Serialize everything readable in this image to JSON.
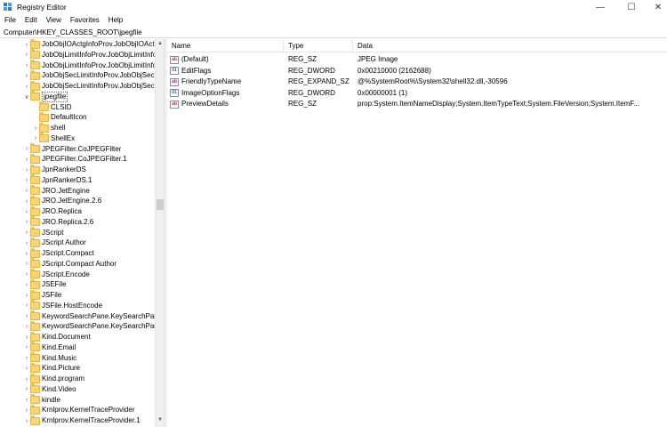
{
  "window": {
    "title": "Registry Editor",
    "min_glyph": "—",
    "max_glyph": "☐",
    "close_glyph": "✕"
  },
  "menu": [
    "File",
    "Edit",
    "View",
    "Favorites",
    "Help"
  ],
  "address": "Computer\\HKEY_CLASSES_ROOT\\jpegfile",
  "tree": [
    {
      "label": "JobObjIOActgInfoProv.JobObjIOActgI",
      "level": 0,
      "expandable": true,
      "expanded": false,
      "selected": false
    },
    {
      "label": "JobObjLimitInfoProv.JobObjLimitInfo",
      "level": 0,
      "expandable": true,
      "expanded": false,
      "selected": false
    },
    {
      "label": "JobObjLimitInfoProv.JobObjLimitInfo",
      "level": 0,
      "expandable": true,
      "expanded": false,
      "selected": false
    },
    {
      "label": "JobObjSecLimitInfoProv.JobObjSecLi",
      "level": 0,
      "expandable": true,
      "expanded": false,
      "selected": false
    },
    {
      "label": "JobObjSecLimitInfoProv.JobObjSecLi",
      "level": 0,
      "expandable": true,
      "expanded": false,
      "selected": false
    },
    {
      "label": "jpegfile",
      "level": 0,
      "expandable": true,
      "expanded": true,
      "selected": true
    },
    {
      "label": "CLSID",
      "level": 1,
      "expandable": false,
      "expanded": false,
      "selected": false
    },
    {
      "label": "DefaultIcon",
      "level": 1,
      "expandable": false,
      "expanded": false,
      "selected": false
    },
    {
      "label": "shell",
      "level": 1,
      "expandable": true,
      "expanded": false,
      "selected": false
    },
    {
      "label": "ShellEx",
      "level": 1,
      "expandable": true,
      "expanded": false,
      "selected": false
    },
    {
      "label": "JPEGFilter.CoJPEGFilter",
      "level": 0,
      "expandable": true,
      "expanded": false,
      "selected": false
    },
    {
      "label": "JPEGFilter.CoJPEGFilter.1",
      "level": 0,
      "expandable": true,
      "expanded": false,
      "selected": false
    },
    {
      "label": "JpnRankerDS",
      "level": 0,
      "expandable": true,
      "expanded": false,
      "selected": false
    },
    {
      "label": "JpnRankerDS.1",
      "level": 0,
      "expandable": true,
      "expanded": false,
      "selected": false
    },
    {
      "label": "JRO.JetEngine",
      "level": 0,
      "expandable": true,
      "expanded": false,
      "selected": false
    },
    {
      "label": "JRO.JetEngine.2.6",
      "level": 0,
      "expandable": true,
      "expanded": false,
      "selected": false
    },
    {
      "label": "JRO.Replica",
      "level": 0,
      "expandable": true,
      "expanded": false,
      "selected": false
    },
    {
      "label": "JRO.Replica.2.6",
      "level": 0,
      "expandable": true,
      "expanded": false,
      "selected": false
    },
    {
      "label": "JScript",
      "level": 0,
      "expandable": true,
      "expanded": false,
      "selected": false
    },
    {
      "label": "JScript Author",
      "level": 0,
      "expandable": true,
      "expanded": false,
      "selected": false
    },
    {
      "label": "JScript.Compact",
      "level": 0,
      "expandable": true,
      "expanded": false,
      "selected": false
    },
    {
      "label": "JScript.Compact Author",
      "level": 0,
      "expandable": true,
      "expanded": false,
      "selected": false
    },
    {
      "label": "JScript.Encode",
      "level": 0,
      "expandable": true,
      "expanded": false,
      "selected": false
    },
    {
      "label": "JSEFile",
      "level": 0,
      "expandable": true,
      "expanded": false,
      "selected": false
    },
    {
      "label": "JSFile",
      "level": 0,
      "expandable": true,
      "expanded": false,
      "selected": false
    },
    {
      "label": "JSFile.HostEncode",
      "level": 0,
      "expandable": true,
      "expanded": false,
      "selected": false
    },
    {
      "label": "KeywordSearchPane.KeySearchPane",
      "level": 0,
      "expandable": true,
      "expanded": false,
      "selected": false
    },
    {
      "label": "KeywordSearchPane.KeySearchPane.",
      "level": 0,
      "expandable": true,
      "expanded": false,
      "selected": false
    },
    {
      "label": "Kind.Document",
      "level": 0,
      "expandable": true,
      "expanded": false,
      "selected": false
    },
    {
      "label": "Kind.Email",
      "level": 0,
      "expandable": true,
      "expanded": false,
      "selected": false
    },
    {
      "label": "Kind.Music",
      "level": 0,
      "expandable": true,
      "expanded": false,
      "selected": false
    },
    {
      "label": "Kind.Picture",
      "level": 0,
      "expandable": true,
      "expanded": false,
      "selected": false
    },
    {
      "label": "Kind.program",
      "level": 0,
      "expandable": true,
      "expanded": false,
      "selected": false
    },
    {
      "label": "Kind.Video",
      "level": 0,
      "expandable": true,
      "expanded": false,
      "selected": false
    },
    {
      "label": "kindle",
      "level": 0,
      "expandable": true,
      "expanded": false,
      "selected": false
    },
    {
      "label": "Krnlprov.KernelTraceProvider",
      "level": 0,
      "expandable": true,
      "expanded": false,
      "selected": false
    },
    {
      "label": "Krnlprov.KernelTraceProvider.1",
      "level": 0,
      "expandable": true,
      "expanded": false,
      "selected": false
    }
  ],
  "columns": {
    "name": "Name",
    "type": "Type",
    "data": "Data"
  },
  "values": [
    {
      "name": "(Default)",
      "type": "REG_SZ",
      "data": "JPEG Image",
      "icon": "string-value-icon",
      "kind": "sz"
    },
    {
      "name": "EditFlags",
      "type": "REG_DWORD",
      "data": "0x00210000 (2162688)",
      "icon": "binary-value-icon",
      "kind": "bin"
    },
    {
      "name": "FriendlyTypeName",
      "type": "REG_EXPAND_SZ",
      "data": "@%SystemRoot%\\System32\\shell32.dll,-30596",
      "icon": "string-value-icon",
      "kind": "sz"
    },
    {
      "name": "ImageOptionFlags",
      "type": "REG_DWORD",
      "data": "0x00000001 (1)",
      "icon": "binary-value-icon",
      "kind": "bin"
    },
    {
      "name": "PreviewDetails",
      "type": "REG_SZ",
      "data": "prop:System.ItemNameDisplay;System.ItemTypeText;System.FileVersion;System.ItemF...",
      "icon": "string-value-icon",
      "kind": "sz"
    }
  ]
}
